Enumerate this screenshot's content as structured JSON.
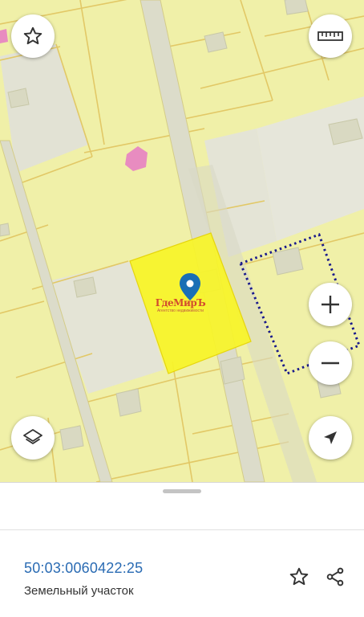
{
  "map": {
    "watermark_title": "ГдеМирЪ",
    "watermark_subtitle": "Агентство недвижимости",
    "colors": {
      "parcel_fill": "#f0f0a8",
      "parcel_border": "#e0c060",
      "road": "#dcdcc8",
      "building_zone": "#e4e4d6",
      "selected_parcel": "#f8f52a",
      "marker": "#1a6fb5",
      "dotted_boundary": "#1a1a8c",
      "pink_building": "#e88cc0"
    },
    "controls": {
      "favorite": "star-icon",
      "ruler": "ruler-icon",
      "zoom_in": "+",
      "zoom_out": "−",
      "layers": "layers-icon",
      "locate": "navigation-arrow-icon"
    }
  },
  "sheet": {
    "cadastral_number": "50:03:0060422:25",
    "object_type": "Земельный участок"
  }
}
